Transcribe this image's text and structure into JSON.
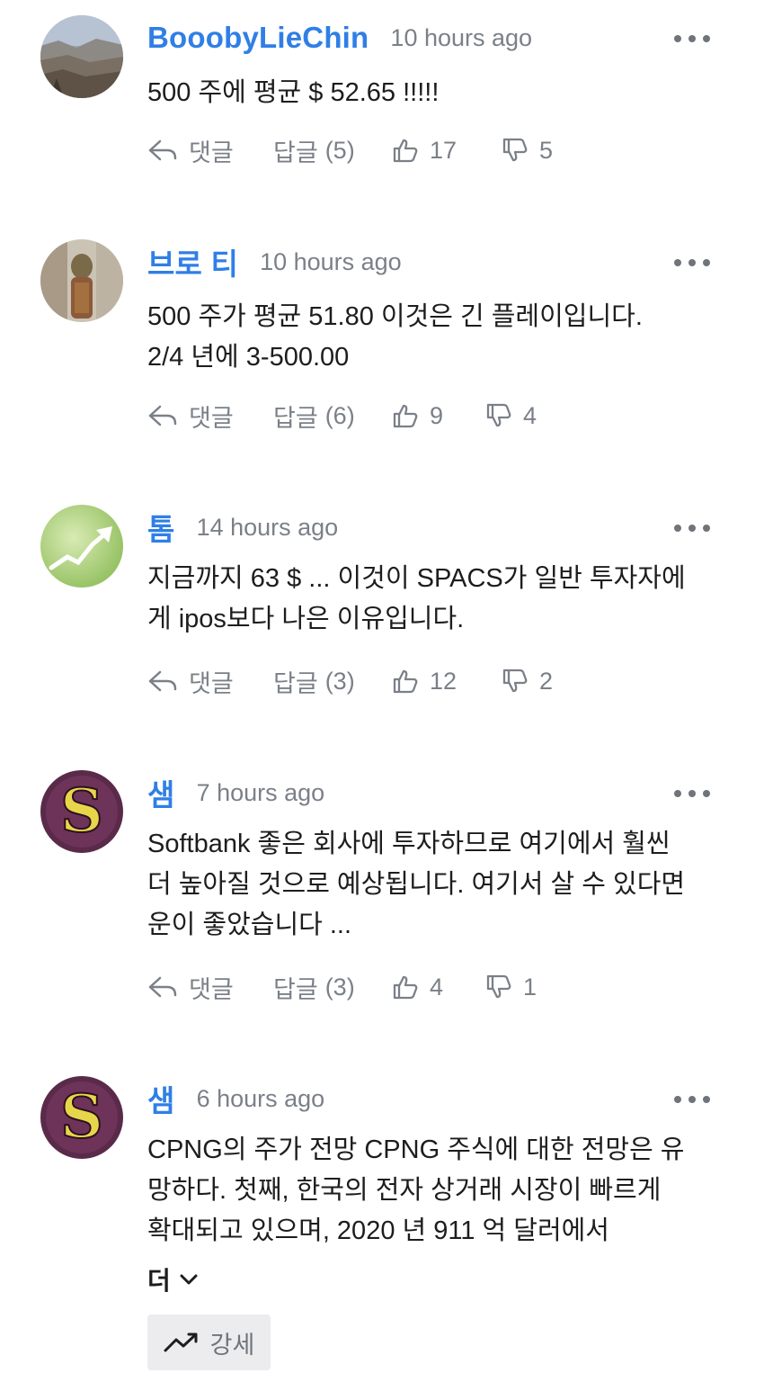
{
  "action_labels": {
    "reply": "댓글",
    "replies_prefix": "답글"
  },
  "comments": [
    {
      "username": "BooobyLieChin",
      "time": "10 hours ago",
      "lines": [
        "500 주에 평균 $ 52.65 !!!!!"
      ],
      "replies": "(5)",
      "likes": "17",
      "dislikes": "5"
    },
    {
      "username": "브로 티",
      "time": "10 hours ago",
      "lines": [
        "500 주가 평균 51.80 이것은 긴 플레이입니다.",
        "2/4 년에 3-500.00"
      ],
      "replies": "(6)",
      "likes": "9",
      "dislikes": "4"
    },
    {
      "username": "톰",
      "time": "14 hours ago",
      "lines": [
        "지금까지 63 $ ... 이것이 SPACS가 일반 투자자에",
        "게 ipos보다 나은 이유입니다."
      ],
      "replies": "(3)",
      "likes": "12",
      "dislikes": "2"
    },
    {
      "username": "샘",
      "time": "7 hours ago",
      "lines": [
        "Softbank 좋은 회사에 투자하므로 여기에서 훨씬",
        "더 높아질 것으로 예상됩니다. 여기서 살 수 있다면",
        "운이 좋았습니다 ..."
      ],
      "replies": "(3)",
      "likes": "4",
      "dislikes": "1"
    },
    {
      "username": "샘",
      "time": "6 hours ago",
      "lines": [
        "CPNG의 주가 전망 CPNG 주식에 대한 전망은 유",
        "망하다. 첫째, 한국의 전자 상거래 시장이 빠르게",
        "확대되고 있으며, 2020 년 911 억 달러에서"
      ],
      "more_label": "더",
      "sentiment_label": "강세"
    }
  ],
  "colors": {
    "username": "#2f7fe6",
    "meta": "#7b8088",
    "body": "#1d1d1f",
    "sentiment_bg": "#ececee"
  },
  "icons": {
    "reply": "reply-arrow-icon",
    "like": "thumbs-up-icon",
    "dislike": "thumbs-down-icon",
    "more": "more-dots-icon",
    "expand": "chevron-down-icon",
    "sentiment": "trending-up-icon"
  }
}
